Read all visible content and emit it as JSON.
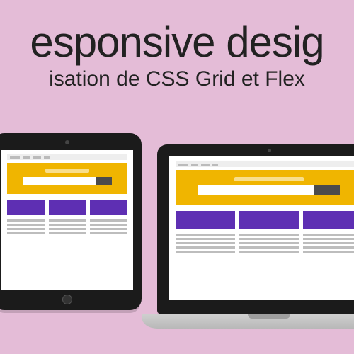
{
  "title": "esponsive desig",
  "subtitle": "isation de CSS Grid et Flex",
  "devices": {
    "tablet": {
      "name": "tablet-device"
    },
    "laptop": {
      "name": "laptop-device"
    }
  },
  "mock_page": {
    "hero_color": "#f0b500",
    "accent_color": "#5e2fb3",
    "columns": 3
  }
}
